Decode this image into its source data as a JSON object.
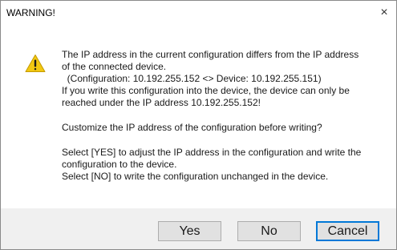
{
  "dialog": {
    "title": "WARNING!",
    "close_glyph": "×",
    "icon": "warning-triangle-icon",
    "lines": [
      "The IP address in the current configuration differs from the IP address",
      "of the connected device.",
      "  (Configuration: 10.192.255.152 <> Device: 10.192.255.151)",
      "If you write this configuration into the device, the device can only be",
      "reached under the IP address 10.192.255.152!",
      "",
      "Customize the IP address of the configuration before writing?",
      "",
      "Select [YES] to adjust the IP address in the configuration and write the",
      "configuration to the device.",
      "Select [NO] to write the configuration unchanged in the device."
    ],
    "buttons": {
      "yes": "Yes",
      "no": "No",
      "cancel": "Cancel"
    },
    "colors": {
      "footer_bg": "#f0f0f0",
      "focus_border": "#0078d7",
      "icon_fill": "#f2c811"
    }
  }
}
